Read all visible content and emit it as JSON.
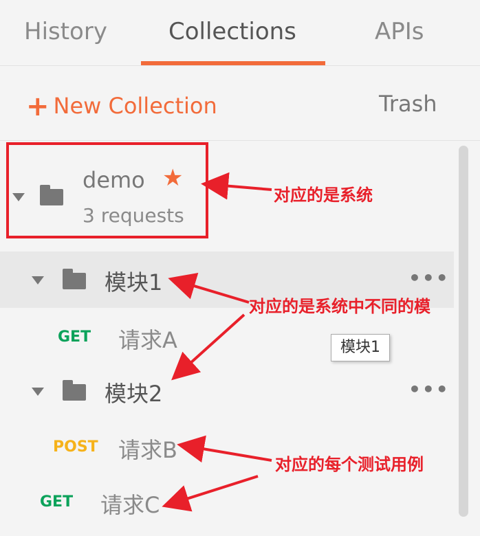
{
  "tabs": [
    "History",
    "Collections",
    "APIs"
  ],
  "actions": {
    "new_collection": "New Collection",
    "trash": "Trash"
  },
  "collection": {
    "name": "demo",
    "requests": "3 requests",
    "starred": true
  },
  "folders": [
    {
      "name": "模块1",
      "requests": [
        {
          "method": "GET",
          "name": "请求A"
        }
      ]
    },
    {
      "name": "模块2",
      "requests": [
        {
          "method": "POST",
          "name": "请求B"
        },
        {
          "method": "GET",
          "name": "请求C"
        }
      ]
    }
  ],
  "tooltip": "模块1",
  "annotations": {
    "system": "对应的是系统",
    "modules": "对应的是系统中不同的模",
    "cases": "对应的每个测试用例"
  },
  "colors": {
    "accent": "#f26b3a",
    "annotation": "#e8202a",
    "get": "#0ba25a",
    "post": "#f6b21a"
  }
}
